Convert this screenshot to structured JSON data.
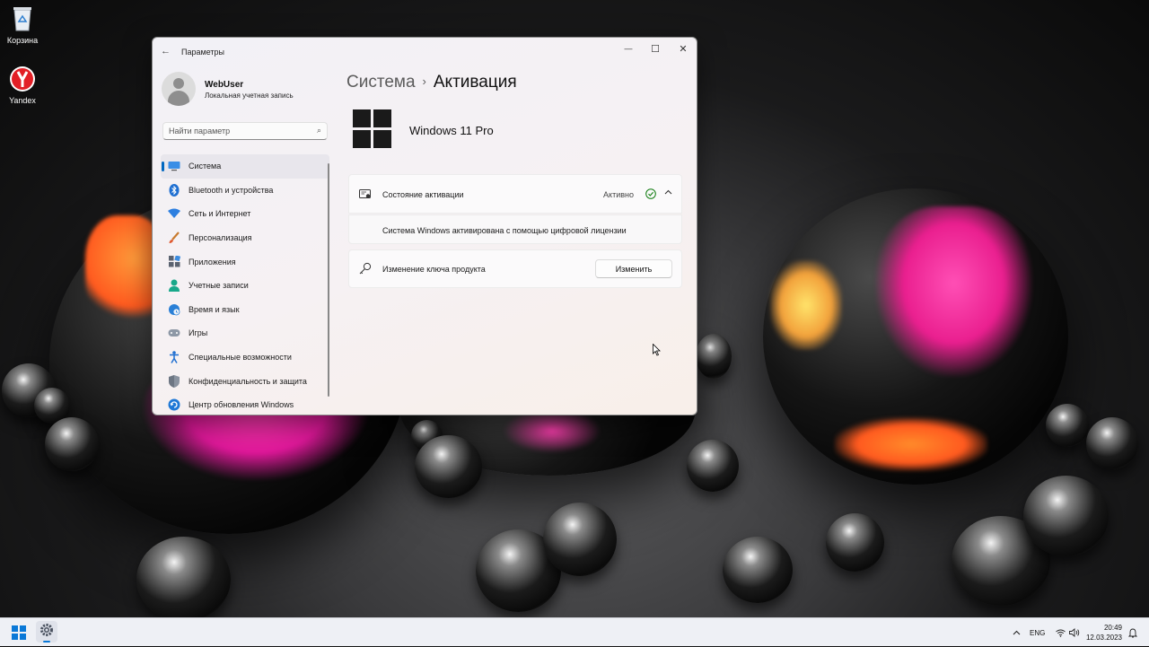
{
  "desktop": {
    "icons": [
      {
        "label": "Корзина",
        "icon": "recycle-bin-icon"
      },
      {
        "label": "Yandex",
        "icon": "yandex-browser-icon"
      }
    ]
  },
  "window": {
    "title": "Параметры",
    "controls": {
      "minimize": "—",
      "maximize": "☐",
      "close": "✕"
    }
  },
  "user": {
    "name": "WebUser",
    "account_type": "Локальная учетная запись"
  },
  "search": {
    "placeholder": "Найти параметр"
  },
  "sidebar": {
    "items": [
      {
        "label": "Система",
        "icon": "monitor-icon",
        "active": true
      },
      {
        "label": "Bluetooth и устройства",
        "icon": "bluetooth-icon"
      },
      {
        "label": "Сеть и Интернет",
        "icon": "wifi-icon"
      },
      {
        "label": "Персонализация",
        "icon": "brush-icon"
      },
      {
        "label": "Приложения",
        "icon": "apps-icon"
      },
      {
        "label": "Учетные записи",
        "icon": "person-icon"
      },
      {
        "label": "Время и язык",
        "icon": "globe-clock-icon"
      },
      {
        "label": "Игры",
        "icon": "gamepad-icon"
      },
      {
        "label": "Специальные возможности",
        "icon": "accessibility-icon"
      },
      {
        "label": "Конфиденциальность и защита",
        "icon": "shield-icon"
      },
      {
        "label": "Центр обновления Windows",
        "icon": "update-icon"
      }
    ]
  },
  "breadcrumb": {
    "parent": "Система",
    "separator": "›",
    "current": "Активация"
  },
  "product": {
    "edition": "Windows 11 Pro"
  },
  "activation": {
    "state_label": "Состояние активации",
    "state_value": "Активно",
    "details": "Система Windows активирована с помощью цифровой лицензии"
  },
  "product_key": {
    "label": "Изменение ключа продукта",
    "button": "Изменить"
  },
  "taskbar": {
    "language": "ENG",
    "time": "20:49",
    "date": "12.03.2023"
  },
  "colors": {
    "accent": "#0067c0",
    "success": "#0f7b0f"
  }
}
